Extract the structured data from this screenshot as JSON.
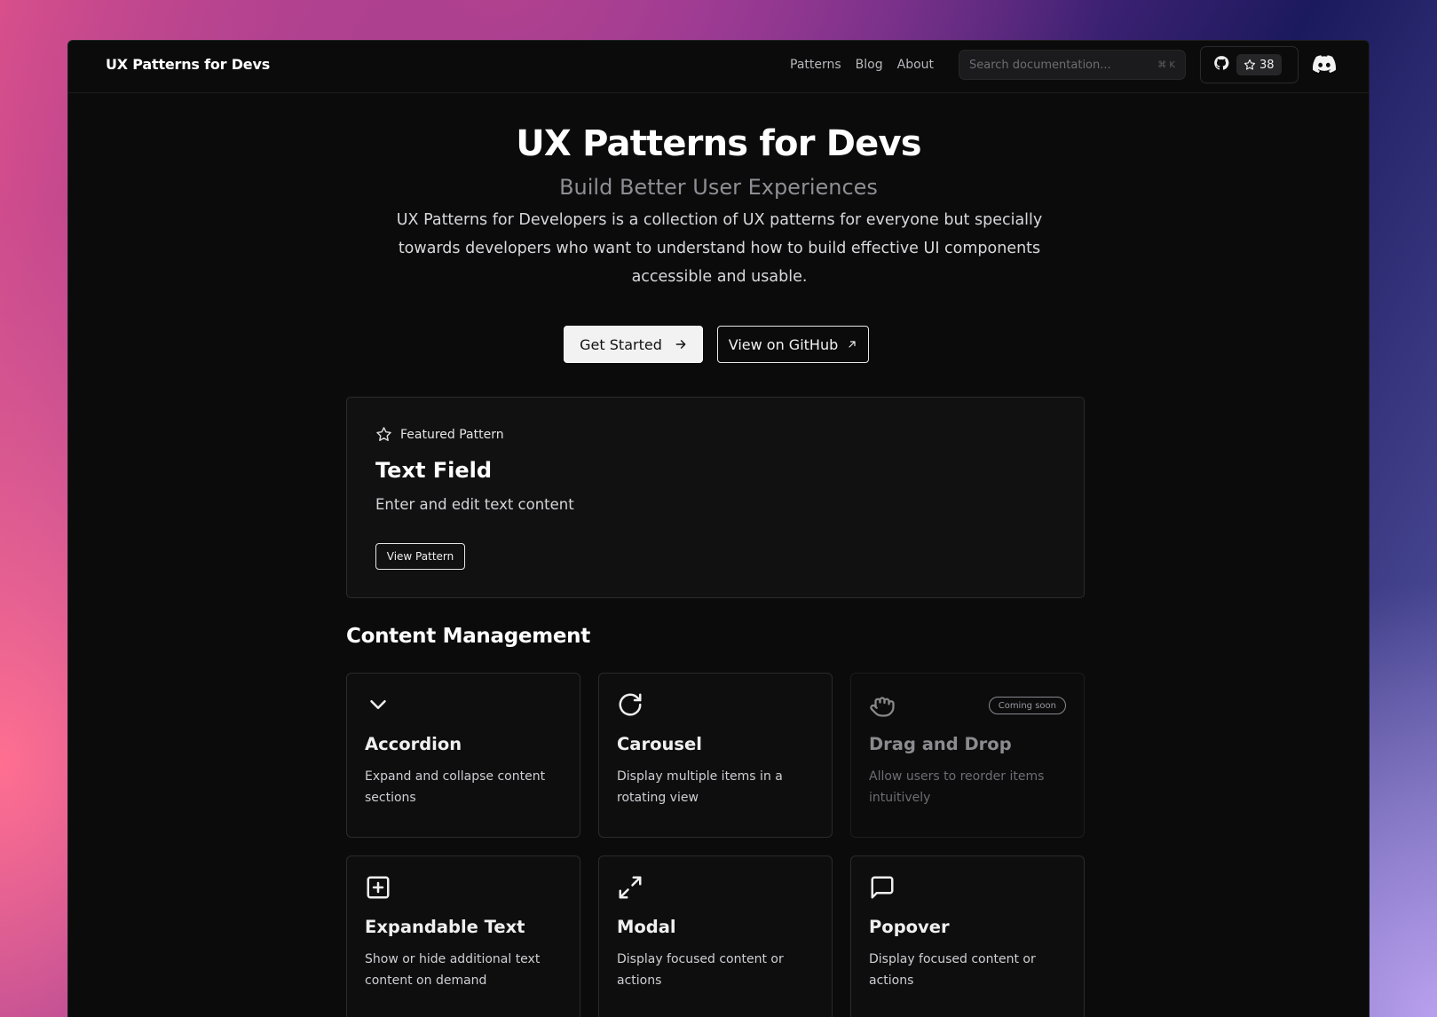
{
  "header": {
    "brand": "UX Patterns for Devs",
    "nav": [
      "Patterns",
      "Blog",
      "About"
    ],
    "search_placeholder": "Search documentation...",
    "search_shortcut": "⌘ K",
    "github_stars": "38"
  },
  "hero": {
    "title": "UX Patterns for Devs",
    "subtitle": "Build Better User Experiences",
    "description": "UX Patterns for Developers is a collection of UX patterns for everyone but specially towards developers who want to understand how to build effective UI components accessible and usable.",
    "primary_button": "Get Started",
    "secondary_button": "View on GitHub"
  },
  "featured": {
    "tag": "Featured Pattern",
    "title": "Text Field",
    "description": "Enter and edit text content",
    "button": "View Pattern"
  },
  "section": {
    "title": "Content Management",
    "cards": [
      {
        "title": "Accordion",
        "description": "Expand and collapse content sections",
        "icon": "chevron-down-icon"
      },
      {
        "title": "Carousel",
        "description": "Display multiple items in a rotating view",
        "icon": "refresh-icon"
      },
      {
        "title": "Drag and Drop",
        "description": "Allow users to reorder items intuitively",
        "icon": "hand-grab-icon",
        "badge": "Coming soon"
      },
      {
        "title": "Expandable Text",
        "description": "Show or hide additional text content on demand",
        "icon": "plus-square-icon"
      },
      {
        "title": "Modal",
        "description": "Display focused content or actions",
        "icon": "expand-icon"
      },
      {
        "title": "Popover",
        "description": "Display focused content or actions",
        "icon": "message-square-icon"
      }
    ]
  },
  "colors": {
    "window_bg": "#0b0b0b",
    "card_border": "#2b2b2e",
    "muted_text": "#8e8e94"
  }
}
